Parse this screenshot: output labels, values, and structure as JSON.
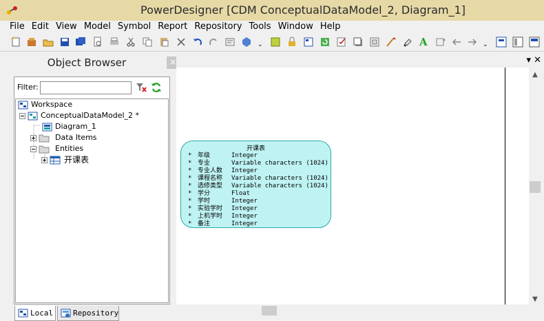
{
  "window": {
    "title": "PowerDesigner [CDM ConceptualDataModel_2, Diagram_1]"
  },
  "menu": [
    "File",
    "Edit",
    "View",
    "Model",
    "Symbol",
    "Report",
    "Repository",
    "Tools",
    "Window",
    "Help"
  ],
  "browser": {
    "title": "Object Browser",
    "close_label": "×",
    "filter_label": "Filter:",
    "filter_value": "",
    "tree": [
      {
        "label": "Workspace",
        "icon": "workspace-icon"
      },
      {
        "label": "ConceptualDataModel_2 *",
        "icon": "model-icon"
      },
      {
        "label": "Diagram_1",
        "icon": "diagram-icon"
      },
      {
        "label": "Data Items",
        "icon": "folder-icon"
      },
      {
        "label": "Entities",
        "icon": "folder-open-icon"
      },
      {
        "label": "开课表",
        "icon": "entity-icon"
      }
    ],
    "tabs": [
      {
        "label": "Local"
      },
      {
        "label": "Repository"
      }
    ]
  },
  "canvas": {
    "controls": "▾ ✕",
    "entity": {
      "name": "开课表",
      "attributes": [
        {
          "marker": "*",
          "name": "年级",
          "type": "Integer"
        },
        {
          "marker": "*",
          "name": "专业",
          "type": "Variable characters (1024)"
        },
        {
          "marker": "*",
          "name": "专业人数",
          "type": "Integer"
        },
        {
          "marker": "*",
          "name": "课程名称",
          "type": "Variable characters (1024)"
        },
        {
          "marker": "*",
          "name": "选修类型",
          "type": "Variable characters (1024)"
        },
        {
          "marker": "*",
          "name": "学分",
          "type": "Float"
        },
        {
          "marker": "*",
          "name": "学时",
          "type": "Integer"
        },
        {
          "marker": "*",
          "name": "实验学时",
          "type": "Integer"
        },
        {
          "marker": "*",
          "name": "上机学时",
          "type": "Integer"
        },
        {
          "marker": "*",
          "name": "备注",
          "type": "Integer"
        }
      ]
    }
  },
  "colors": {
    "titlebar": "#e6d9a6",
    "entity_fill": "#bff3f3",
    "entity_border": "#2aa8a8"
  }
}
